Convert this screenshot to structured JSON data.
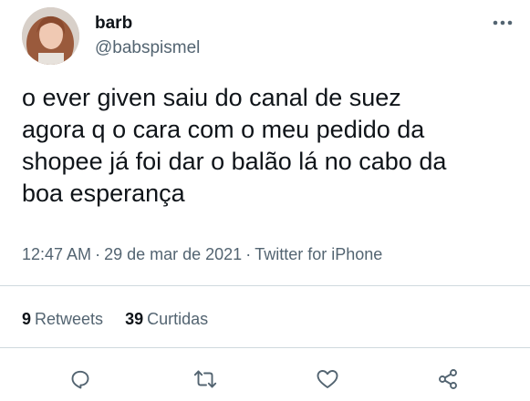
{
  "author": {
    "display_name": "barb",
    "handle": "@babspismel"
  },
  "icons": {
    "more": "more-horizontal-icon",
    "reply": "reply-icon",
    "retweet": "retweet-icon",
    "like": "heart-icon",
    "share": "share-icon"
  },
  "tweet": {
    "text": "o ever given saiu do canal de suez\nagora q o cara com o meu pedido da\nshopee já foi dar o balão lá no cabo da\nboa esperança",
    "time": "12:47 AM",
    "separator": "·",
    "date": "29 de mar de 2021",
    "source": "Twitter for iPhone"
  },
  "stats": {
    "retweets_count": "9",
    "retweets_label": "Retweets",
    "likes_count": "39",
    "likes_label": "Curtidas"
  },
  "colors": {
    "text_primary": "#0f1419",
    "text_secondary": "#536471",
    "divider": "#cfd9de",
    "icon": "#536471"
  }
}
